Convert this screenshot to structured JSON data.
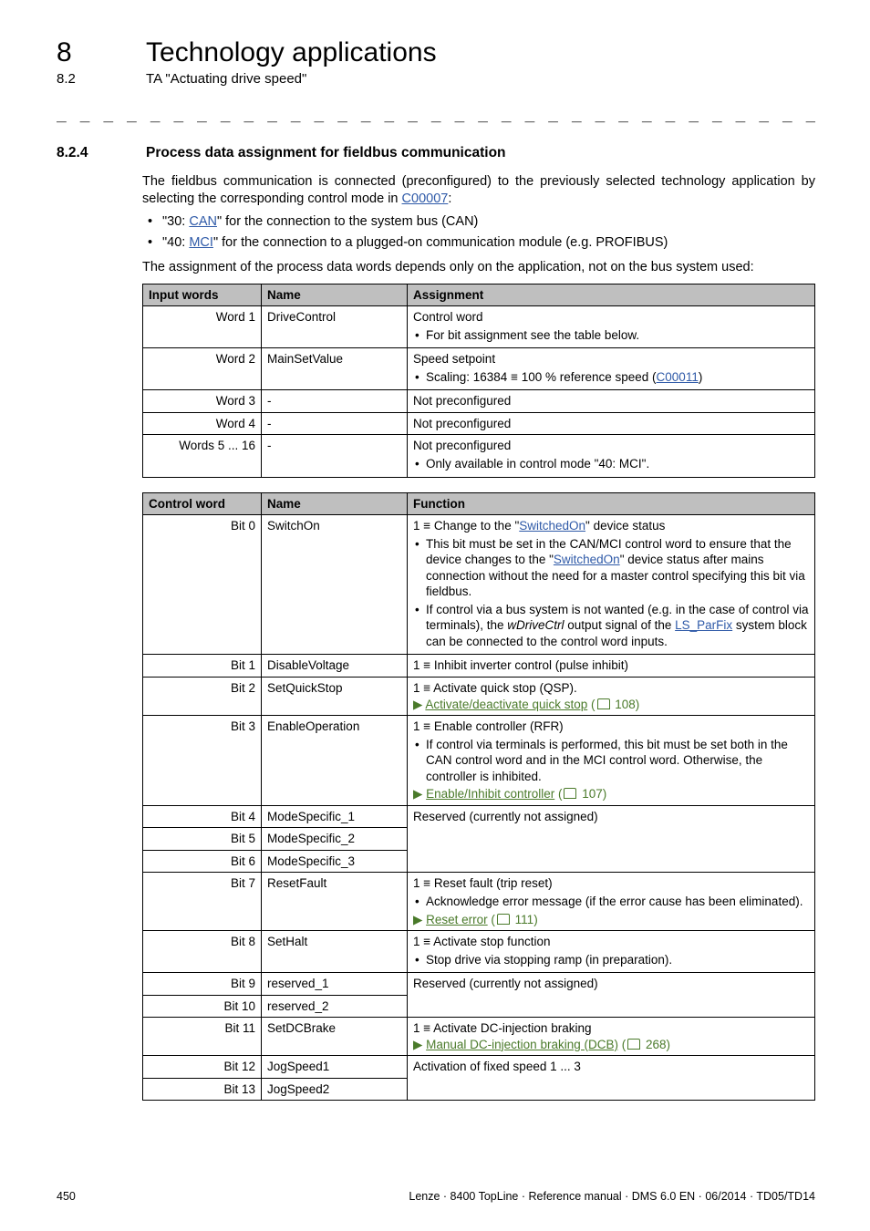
{
  "header": {
    "chapter_number": "8",
    "chapter_title": "Technology applications",
    "sub_number": "8.2",
    "sub_title": "TA \"Actuating drive speed\""
  },
  "section": {
    "number": "8.2.4",
    "title": "Process data assignment for fieldbus communication",
    "intro_before": "The fieldbus communication is connected (preconfigured) to the previously selected technology application by selecting the corresponding control mode in ",
    "intro_link": "C00007",
    "intro_after": ":",
    "bullet1_prefix": "\"30: ",
    "bullet1_link": "CAN",
    "bullet1_suffix": "\" for the connection to the system bus (CAN)",
    "bullet2_prefix": "\"40: ",
    "bullet2_link": "MCI",
    "bullet2_suffix": "\" for the connection to a plugged-on communication module (e.g. PROFIBUS)",
    "assignment_note": "The assignment of the process data words depends only on the application, not on the bus system used:"
  },
  "table1": {
    "headers": [
      "Input words",
      "Name",
      "Assignment"
    ],
    "rows": [
      {
        "c0": "Word 1",
        "c1": "DriveControl",
        "c2_line1": "Control word",
        "c2_b1": "For bit assignment see the table below."
      },
      {
        "c0": "Word 2",
        "c1": "MainSetValue",
        "c2_line1": "Speed setpoint",
        "c2_b1_before": "Scaling: 16384 ≡ 100 % reference speed (",
        "c2_b1_link": "C00011",
        "c2_b1_after": ")"
      },
      {
        "c0": "Word 3",
        "c1": "-",
        "c2_line1": "Not preconfigured"
      },
      {
        "c0": "Word 4",
        "c1": "-",
        "c2_line1": "Not preconfigured"
      },
      {
        "c0": "Words 5 ... 16",
        "c1": "-",
        "c2_line1": "Not preconfigured",
        "c2_b1": "Only available in control mode \"40: MCI\"."
      }
    ]
  },
  "table2": {
    "headers": [
      "Control word",
      "Name",
      "Function"
    ],
    "rows": [
      {
        "c0": "Bit 0",
        "c1": "SwitchOn",
        "f_line_before": "1 ≡ Change to the \"",
        "f_line_link": "SwitchedOn",
        "f_line_after": "\" device status",
        "b1_before": "This bit must be set in the CAN/MCI control word to ensure that the device changes to the \"",
        "b1_link": "SwitchedOn",
        "b1_after": "\" device status after mains connection without the need for a master control specifying this bit via fieldbus.",
        "b2_before": "If control via a bus system is not wanted (e.g. in the case of control via terminals), the ",
        "b2_italic": "wDriveCtrl",
        "b2_mid": " output signal of the ",
        "b2_link": "LS_ParFix",
        "b2_after": " system block can be connected to the control word inputs."
      },
      {
        "c0": "Bit 1",
        "c1": "DisableVoltage",
        "f_line": "1 ≡ Inhibit inverter control (pulse inhibit)"
      },
      {
        "c0": "Bit 2",
        "c1": "SetQuickStop",
        "f_line": "1 ≡ Activate quick stop (QSP).",
        "link_arrow": "Activate/deactivate quick stop",
        "link_page": " 108)"
      },
      {
        "c0": "Bit 3",
        "c1": "EnableOperation",
        "f_line": "1 ≡ Enable controller (RFR)",
        "b1": "If control via terminals is performed, this bit must be set both in the CAN control word and in the MCI control word. Otherwise, the controller is inhibited.",
        "link_arrow": "Enable/Inhibit controller",
        "link_page": " 107)"
      },
      {
        "c0": "Bit 4",
        "c1": "ModeSpecific_1",
        "f_line": "Reserved (currently not assigned)"
      },
      {
        "c0": "Bit 5",
        "c1": "ModeSpecific_2"
      },
      {
        "c0": "Bit 6",
        "c1": "ModeSpecific_3"
      },
      {
        "c0": "Bit 7",
        "c1": "ResetFault",
        "f_line": "1 ≡ Reset fault (trip reset)",
        "b1": "Acknowledge error message (if the error cause has been eliminated).",
        "link_arrow": "Reset error",
        "link_page": " 111)"
      },
      {
        "c0": "Bit 8",
        "c1": "SetHalt",
        "f_line": "1 ≡ Activate stop function",
        "b1": "Stop drive via stopping ramp (in preparation)."
      },
      {
        "c0": "Bit 9",
        "c1": "reserved_1",
        "f_line": "Reserved (currently not assigned)"
      },
      {
        "c0": "Bit 10",
        "c1": "reserved_2"
      },
      {
        "c0": "Bit 11",
        "c1": "SetDCBrake",
        "f_line": "1 ≡ Activate DC-injection braking",
        "link_arrow": "Manual DC-injection braking (DCB)",
        "link_page": " 268)"
      },
      {
        "c0": "Bit 12",
        "c1": "JogSpeed1",
        "f_line": "Activation of fixed speed 1 ... 3"
      },
      {
        "c0": "Bit 13",
        "c1": "JogSpeed2"
      }
    ]
  },
  "footer": {
    "page": "450",
    "ref": "Lenze · 8400 TopLine · Reference manual · DMS 6.0 EN · 06/2014 · TD05/TD14"
  }
}
